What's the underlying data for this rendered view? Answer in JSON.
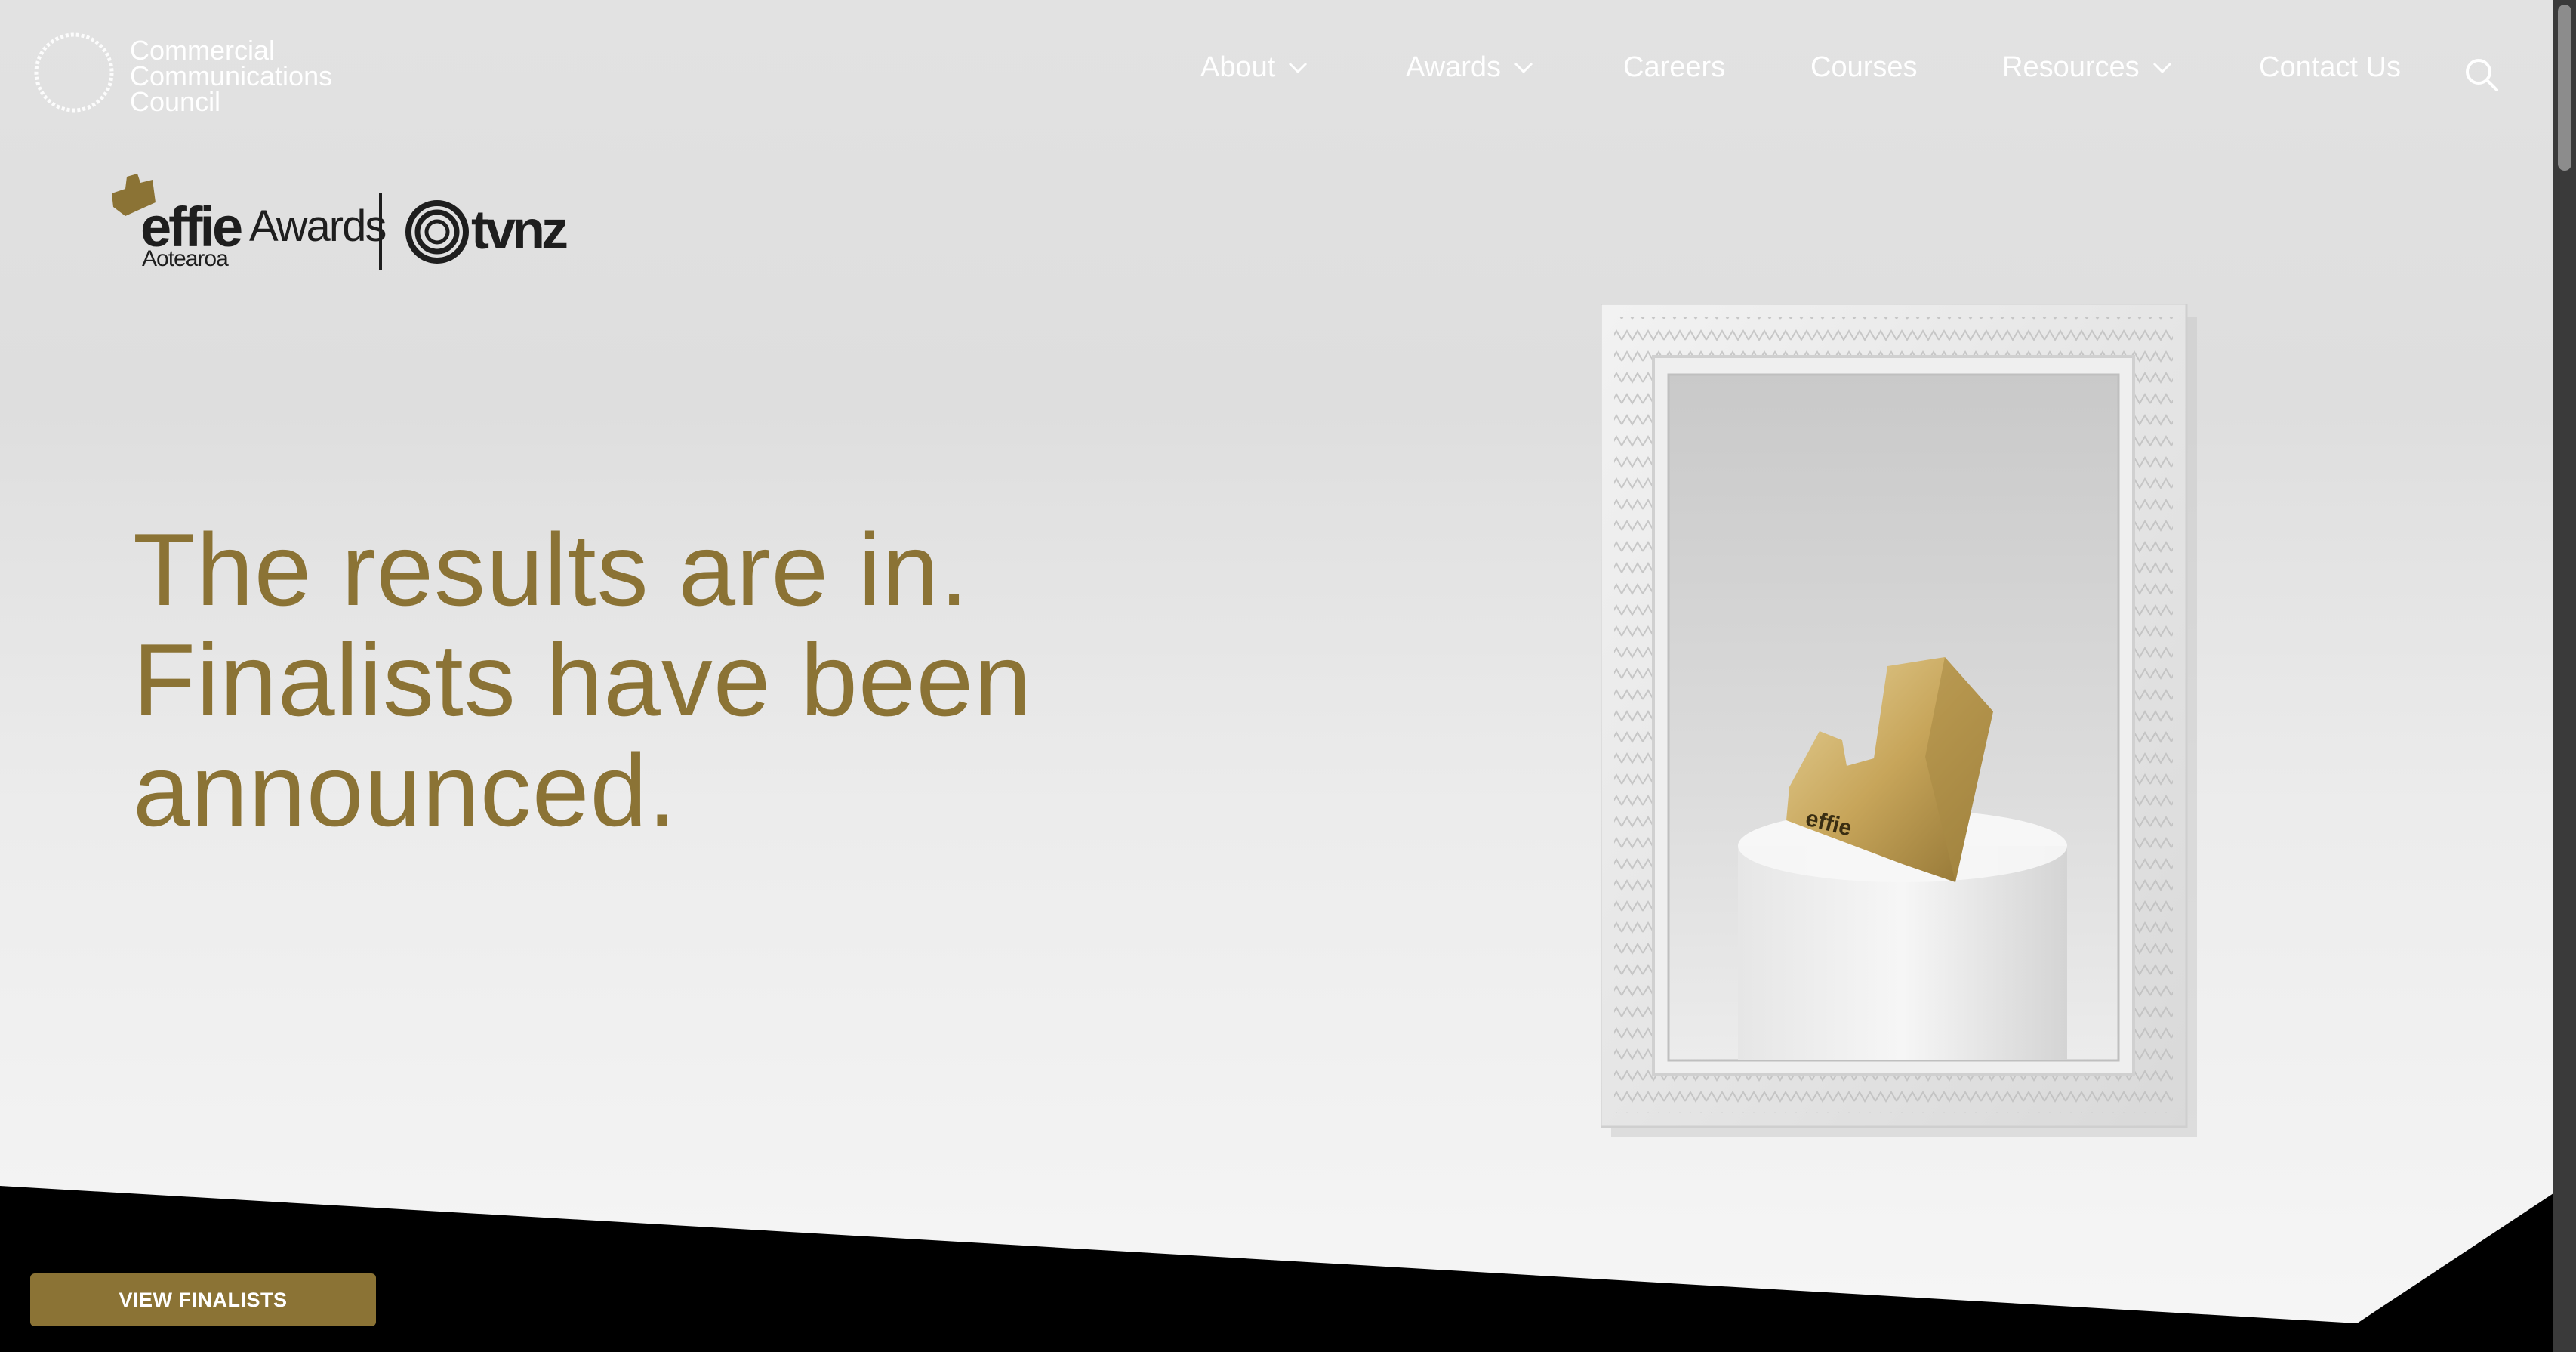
{
  "site": {
    "logo_lines": [
      "Commercial",
      "Communications",
      "Council"
    ]
  },
  "nav": {
    "items": [
      {
        "label": "About",
        "has_dropdown": true
      },
      {
        "label": "Awards",
        "has_dropdown": true
      },
      {
        "label": "Careers",
        "has_dropdown": false
      },
      {
        "label": "Courses",
        "has_dropdown": false
      },
      {
        "label": "Resources",
        "has_dropdown": true
      },
      {
        "label": "Contact Us",
        "has_dropdown": false
      }
    ],
    "search_icon": "search-icon"
  },
  "brand_lockup": {
    "effie": "effie",
    "awards": "Awards",
    "region": "Aotearoa",
    "partner": "tvnz"
  },
  "hero": {
    "headline_lines": [
      "The results are in.",
      "Finalists have been",
      "announced."
    ],
    "cta_label": "VIEW FINALISTS",
    "trophy_mark": "effie"
  },
  "colors": {
    "accent_gold": "#8b7335",
    "nav_text": "#ffffff",
    "dark": "#1e1e1e"
  }
}
